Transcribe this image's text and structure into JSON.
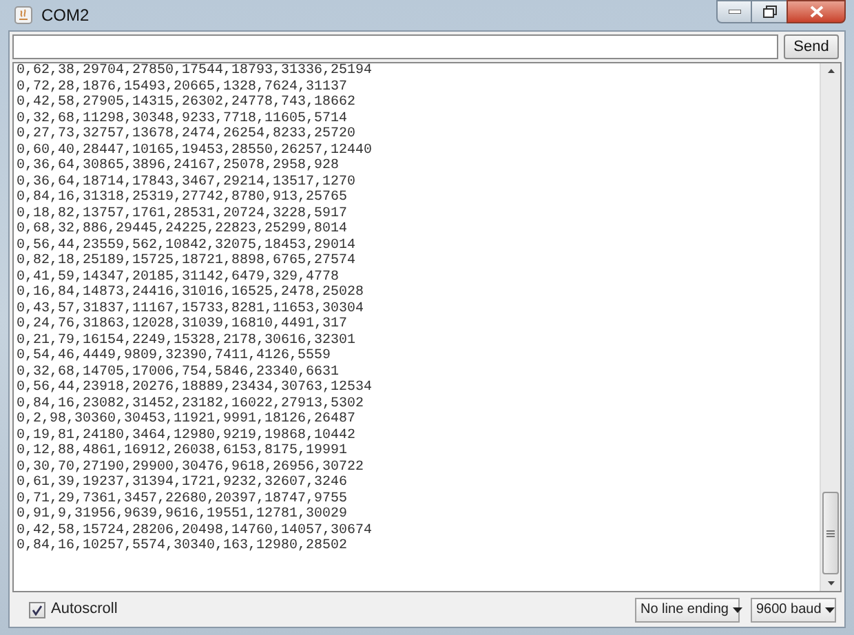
{
  "window": {
    "title": "COM2"
  },
  "send_button": "Send",
  "output_lines": [
    "0,62,38,29704,27850,17544,18793,31336,25194",
    "0,72,28,1876,15493,20665,1328,7624,31137",
    "0,42,58,27905,14315,26302,24778,743,18662",
    "0,32,68,11298,30348,9233,7718,11605,5714",
    "0,27,73,32757,13678,2474,26254,8233,25720",
    "0,60,40,28447,10165,19453,28550,26257,12440",
    "0,36,64,30865,3896,24167,25078,2958,928",
    "0,36,64,18714,17843,3467,29214,13517,1270",
    "0,84,16,31318,25319,27742,8780,913,25765",
    "0,18,82,13757,1761,28531,20724,3228,5917",
    "0,68,32,886,29445,24225,22823,25299,8014",
    "0,56,44,23559,562,10842,32075,18453,29014",
    "0,82,18,25189,15725,18721,8898,6765,27574",
    "0,41,59,14347,20185,31142,6479,329,4778",
    "0,16,84,14873,24416,31016,16525,2478,25028",
    "0,43,57,31837,11167,15733,8281,11653,30304",
    "0,24,76,31863,12028,31039,16810,4491,317",
    "0,21,79,16154,2249,15328,2178,30616,32301",
    "0,54,46,4449,9809,32390,7411,4126,5559",
    "0,32,68,14705,17006,754,5846,23340,6631",
    "0,56,44,23918,20276,18889,23434,30763,12534",
    "0,84,16,23082,31452,23182,16022,27913,5302",
    "0,2,98,30360,30453,11921,9991,18126,26487",
    "0,19,81,24180,3464,12980,9219,19868,10442",
    "0,12,88,4861,16912,26038,6153,8175,19991",
    "0,30,70,27190,29900,30476,9618,26956,30722",
    "0,61,39,19237,31394,1721,9232,32607,3246",
    "0,71,29,7361,3457,22680,20397,18747,9755",
    "0,91,9,31956,9639,9616,19551,12781,30029",
    "0,42,58,15724,28206,20498,14760,14057,30674",
    "0,84,16,10257,5574,30340,163,12980,28502"
  ],
  "autoscroll": {
    "label": "Autoscroll",
    "checked": true
  },
  "line_ending": {
    "value": "No line ending"
  },
  "baud_rate": {
    "value": "9600 baud"
  }
}
